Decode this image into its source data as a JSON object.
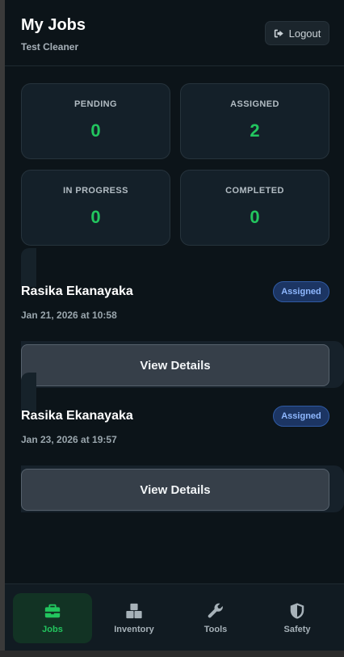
{
  "header": {
    "title": "My Jobs",
    "subtitle": "Test Cleaner",
    "logout_label": "Logout"
  },
  "stats": [
    {
      "label": "PENDING",
      "value": "0"
    },
    {
      "label": "ASSIGNED",
      "value": "2"
    },
    {
      "label": "IN PROGRESS",
      "value": "0"
    },
    {
      "label": "COMPLETED",
      "value": "0"
    }
  ],
  "jobs": [
    {
      "name": "Rasika Ekanayaka",
      "date": "Jan 21, 2026 at 10:58",
      "status": "Assigned",
      "button": "View Details"
    },
    {
      "name": "Rasika Ekanayaka",
      "date": "Jan 23, 2026 at 19:57",
      "status": "Assigned",
      "button": "View Details"
    }
  ],
  "nav": [
    {
      "label": "Jobs",
      "icon": "briefcase-icon",
      "active": true
    },
    {
      "label": "Inventory",
      "icon": "boxes-icon",
      "active": false
    },
    {
      "label": "Tools",
      "icon": "wrench-icon",
      "active": false
    },
    {
      "label": "Safety",
      "icon": "shield-icon",
      "active": false
    }
  ],
  "colors": {
    "accent": "#22c55e",
    "background": "#0c1419",
    "badge": "#1c3563"
  }
}
